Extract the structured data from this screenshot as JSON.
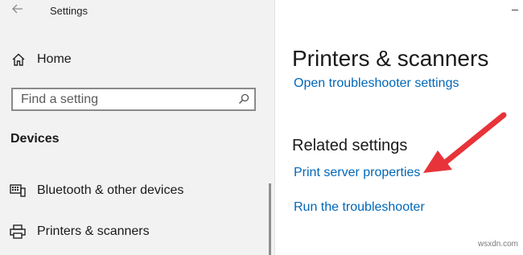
{
  "window": {
    "title": "Settings",
    "back_icon": "back-arrow-icon",
    "minimize_icon": "minimize-icon"
  },
  "sidebar": {
    "home_label": "Home",
    "home_icon": "home-icon",
    "search_placeholder": "Find a setting",
    "search_icon": "search-icon",
    "section_heading": "Devices",
    "items": [
      {
        "label": "Bluetooth & other devices",
        "icon": "bluetooth-devices-icon"
      },
      {
        "label": "Printers & scanners",
        "icon": "printer-icon"
      }
    ]
  },
  "main": {
    "page_title": "Printers & scanners",
    "troubleshooter_settings_link": "Open troubleshooter settings",
    "related_heading": "Related settings",
    "print_server_link": "Print server properties",
    "run_troubleshooter_link": "Run the troubleshooter"
  },
  "annotation": {
    "arrow_color": "#e8333a",
    "arrow_icon": "annotation-arrow-icon"
  },
  "colors": {
    "sidebar_bg": "#f2f2f2",
    "link": "#0067b8",
    "text": "#1a1a1a"
  },
  "watermark": "wsxdn.com"
}
